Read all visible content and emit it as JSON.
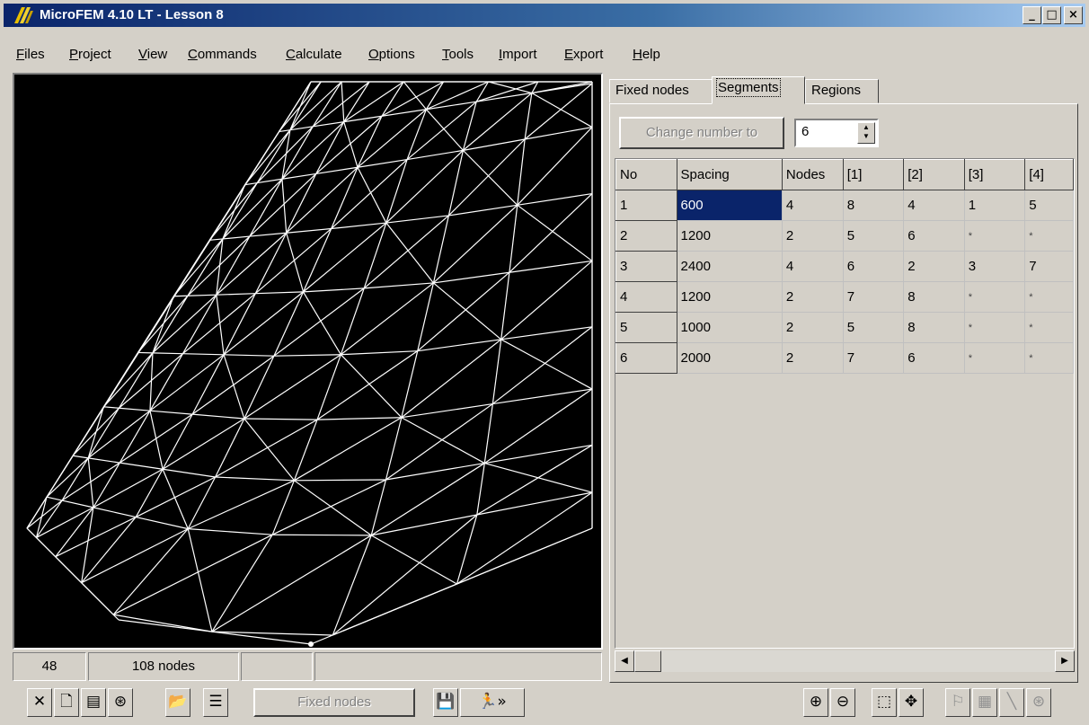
{
  "window": {
    "title": "MicroFEM 4.10 LT - Lesson 8",
    "minimize": "_",
    "maximize": "□",
    "close": "×"
  },
  "menu": [
    "Files",
    "Project",
    "View",
    "Commands",
    "Calculate",
    "Options",
    "Tools",
    "Import",
    "Export",
    "Help"
  ],
  "status": {
    "value": "48",
    "nodes": "108 nodes",
    "panel3": "",
    "panel4": ""
  },
  "tabs": [
    "Fixed nodes",
    "Segments",
    "Regions"
  ],
  "active_tab": "Segments",
  "controls": {
    "change_number_label": "Change number to",
    "number_value": "6"
  },
  "grid": {
    "columns": [
      "No",
      "Spacing",
      "Nodes",
      "[1]",
      "[2]",
      "[3]",
      "[4]"
    ],
    "rows": [
      [
        "1",
        "600",
        "4",
        "8",
        "4",
        "1",
        "5"
      ],
      [
        "2",
        "1200",
        "2",
        "5",
        "6",
        "*",
        "*"
      ],
      [
        "3",
        "2400",
        "4",
        "6",
        "2",
        "3",
        "7"
      ],
      [
        "4",
        "1200",
        "2",
        "7",
        "8",
        "*",
        "*"
      ],
      [
        "5",
        "1000",
        "2",
        "5",
        "8",
        "*",
        "*"
      ],
      [
        "6",
        "2000",
        "2",
        "7",
        "6",
        "*",
        "*"
      ]
    ]
  },
  "toolbar": {
    "fixed_nodes_label": "Fixed nodes"
  },
  "icons": {
    "delete": "delete-icon",
    "new": "new-document-icon",
    "layers": "layers-icon",
    "mesh": "mesh-icon",
    "open": "open-folder-icon",
    "list": "list-icon",
    "save": "save-icon",
    "run": "run-icon",
    "zoom_in": "zoom-in-icon",
    "zoom_out": "zoom-out-icon",
    "select": "select-zoom-icon",
    "pan": "pan-icon"
  },
  "colors": {
    "title_start": "#0a246a",
    "title_end": "#a6caf0",
    "selection": "#0a246a",
    "canvas": "#000000",
    "mesh": "#ffffff"
  }
}
